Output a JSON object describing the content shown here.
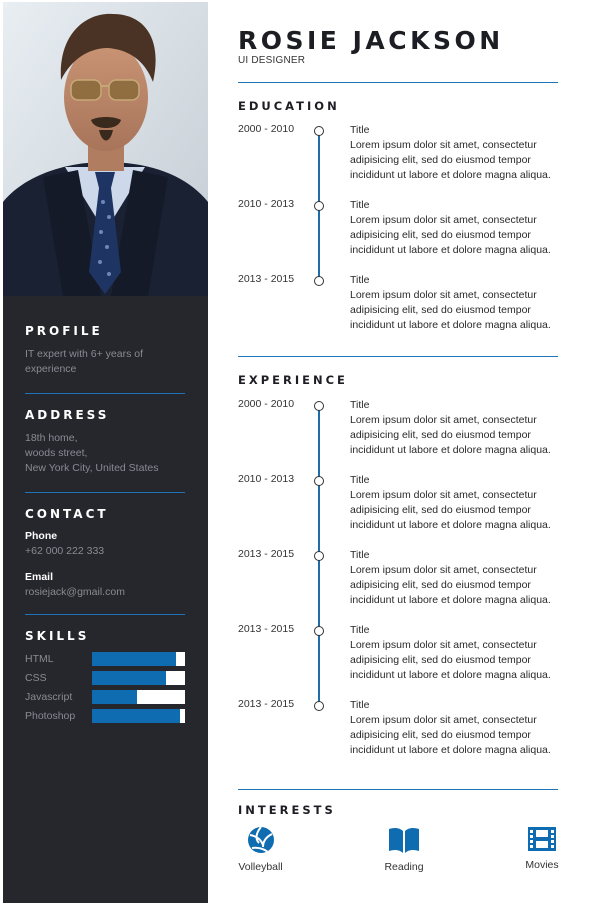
{
  "profile": {
    "name": "ROSIE JACKSON",
    "role": "UI DESIGNER"
  },
  "sidebar": {
    "profile_heading": "PROFILE",
    "profile_text": "IT expert with 6+ years of experience",
    "address_heading": "ADDRESS",
    "address_lines": [
      "18th home,",
      "woods street,",
      "New York City, United States"
    ],
    "contact_heading": "CONTACT",
    "phone_label": "Phone",
    "phone": "+62 000 222 333",
    "email_label": "Email",
    "email": "rosiejack@gmail.com",
    "skills_heading": "SKILLS",
    "skills": [
      {
        "name": "HTML",
        "level": 0.9
      },
      {
        "name": "CSS",
        "level": 0.8
      },
      {
        "name": "Javascript",
        "level": 0.49
      },
      {
        "name": "Photoshop",
        "level": 0.95
      }
    ]
  },
  "education": {
    "heading": "EDUCATION",
    "entries": [
      {
        "years": "2000 - 2010",
        "title": "Title",
        "text": "Lorem ipsum dolor sit amet, consectetur adipisicing elit, sed do eiusmod tempor incididunt ut labore et dolore magna aliqua."
      },
      {
        "years": "2010 - 2013",
        "title": "Title",
        "text": "Lorem ipsum dolor sit amet, consectetur adipisicing elit, sed do eiusmod tempor incididunt ut labore et dolore magna aliqua."
      },
      {
        "years": "2013 - 2015",
        "title": "Title",
        "text": "Lorem ipsum dolor sit amet, consectetur adipisicing elit, sed do eiusmod tempor incididunt ut labore et dolore magna aliqua."
      }
    ]
  },
  "experience": {
    "heading": "EXPERIENCE",
    "entries": [
      {
        "years": "2000 - 2010",
        "title": "Title",
        "text": "Lorem ipsum dolor sit amet, consectetur adipisicing elit, sed do eiusmod tempor incididunt ut labore et dolore magna aliqua."
      },
      {
        "years": "2010 - 2013",
        "title": "Title",
        "text": "Lorem ipsum dolor sit amet, consectetur adipisicing elit, sed do eiusmod tempor incididunt ut labore et dolore magna aliqua."
      },
      {
        "years": "2013 - 2015",
        "title": "Title",
        "text": "Lorem ipsum dolor sit amet, consectetur adipisicing elit, sed do eiusmod tempor incididunt ut labore et dolore magna aliqua."
      },
      {
        "years": "2013 - 2015",
        "title": "Title",
        "text": "Lorem ipsum dolor sit amet, consectetur adipisicing elit, sed do eiusmod tempor incididunt ut labore et dolore magna aliqua."
      },
      {
        "years": "2013 - 2015",
        "title": "Title",
        "text": "Lorem ipsum dolor sit amet, consectetur adipisicing elit, sed do eiusmod tempor incididunt ut labore et dolore magna aliqua."
      }
    ]
  },
  "interests": {
    "heading": "INTERESTS",
    "items": [
      {
        "label": "Volleyball",
        "icon": "volleyball-icon"
      },
      {
        "label": "Reading",
        "icon": "book-icon"
      },
      {
        "label": "Movies",
        "icon": "film-icon"
      }
    ]
  },
  "colors": {
    "sidebar_bg": "#26262d",
    "accent": "#0f6cb0",
    "separator": "#1f73b7"
  }
}
